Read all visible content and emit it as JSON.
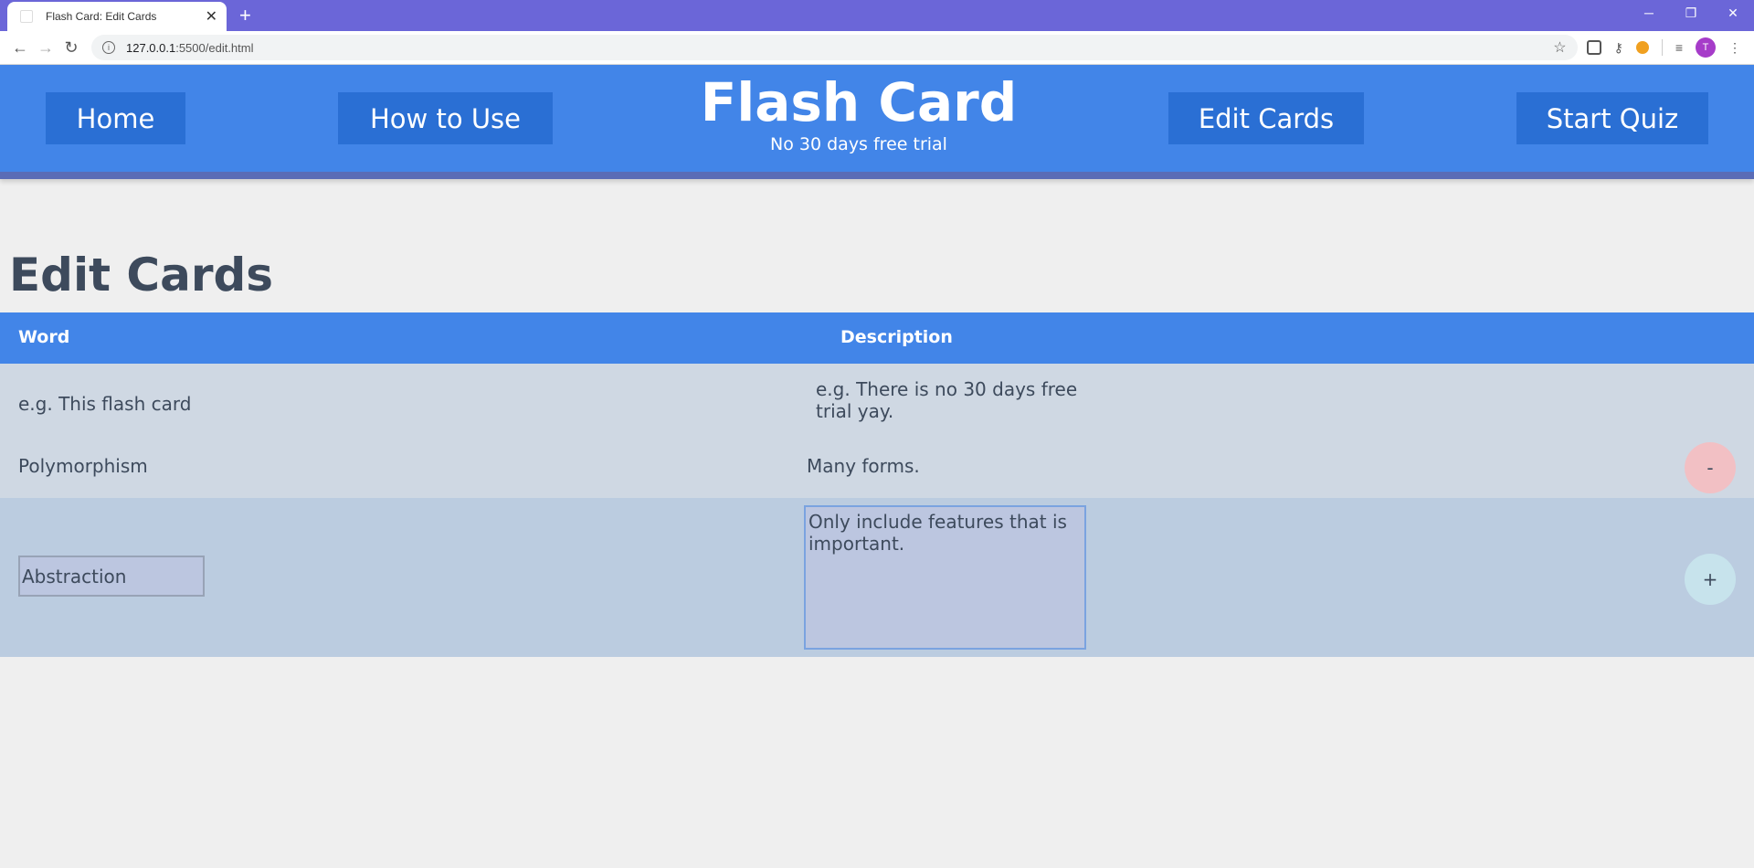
{
  "browser": {
    "tab_title": "Flash Card: Edit Cards",
    "tab_close": "✕",
    "new_tab": "+",
    "url_host": "127.0.0.1",
    "url_rest": ":5500/edit.html",
    "avatar_letter": "T"
  },
  "header": {
    "nav": {
      "home": "Home",
      "how_to_use": "How to Use",
      "edit_cards": "Edit Cards",
      "start_quiz": "Start Quiz"
    },
    "brand_name": "Flash Card",
    "tagline": "No 30 days free trial"
  },
  "page": {
    "title": "Edit Cards"
  },
  "table": {
    "columns": [
      "Word",
      "Description"
    ],
    "placeholder_row": {
      "word": "e.g. This flash card",
      "description": "e.g. There is no 30 days free trial yay."
    },
    "rows": [
      {
        "word": "Polymorphism",
        "description": "Many forms.",
        "action": "-"
      }
    ],
    "new_entry": {
      "word_value": "Abstraction",
      "description_value": "Only include features that is important.",
      "action": "+"
    }
  },
  "colors": {
    "primary": "#4285e8",
    "nav_button": "#2a6fd4",
    "text_dark": "#3d4a5c",
    "remove": "#f2c0c4",
    "add": "#c7e3ec"
  }
}
